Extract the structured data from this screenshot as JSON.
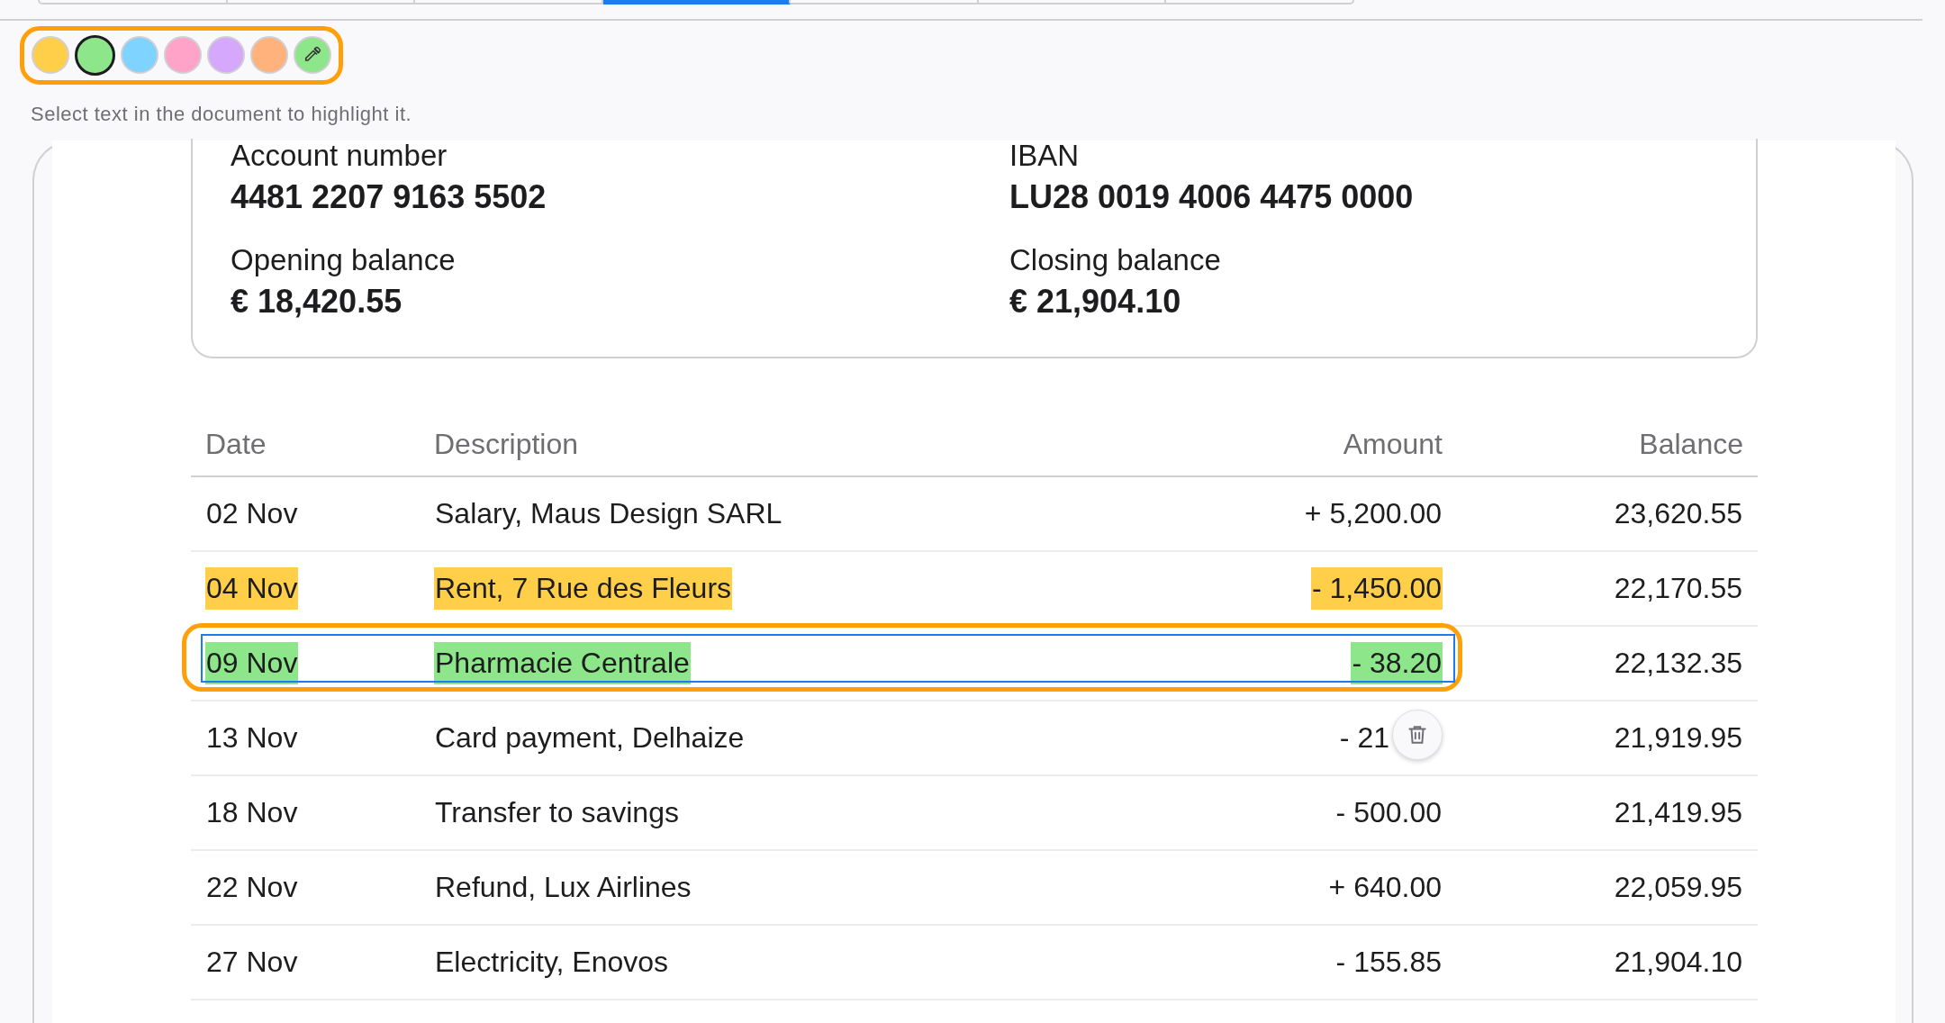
{
  "tabs": [
    {
      "selected": false
    },
    {
      "selected": false
    },
    {
      "selected": false
    },
    {
      "selected": true
    },
    {
      "selected": false
    },
    {
      "selected": false
    },
    {
      "selected": false
    }
  ],
  "highlighter": {
    "focused": true,
    "swatches": [
      {
        "kind": "color",
        "color": "#ffcf4a",
        "selected": false
      },
      {
        "kind": "color",
        "color": "#8de68a",
        "selected": true
      },
      {
        "kind": "color",
        "color": "#7fd3ff",
        "selected": false
      },
      {
        "kind": "color",
        "color": "#ffa3c9",
        "selected": false
      },
      {
        "kind": "color",
        "color": "#d5a8fb",
        "selected": false
      },
      {
        "kind": "color",
        "color": "#ffb27c",
        "selected": false
      },
      {
        "kind": "picker",
        "color": "#8de68a",
        "selected": false
      }
    ]
  },
  "hint": "Select text in the document to highlight it.",
  "account": [
    {
      "label": "Account number",
      "value": "4481 2207 9163 5502"
    },
    {
      "label": "IBAN",
      "value": "LU28 0019 4006 4475 0000"
    },
    {
      "label": "Opening balance",
      "value": "€ 18,420.55"
    },
    {
      "label": "Closing balance",
      "value": "€ 21,904.10"
    }
  ],
  "table": {
    "columns": [
      "Date",
      "Description",
      "Amount",
      "Balance"
    ],
    "rows": [
      {
        "date": "02 Nov",
        "description": "Salary, Maus Design SARL",
        "amount": "+ 5,200.00",
        "balance": "23,620.55",
        "selected": false,
        "delete_button": false
      },
      {
        "date": "04 Nov",
        "description": "Rent, 7 Rue des Fleurs",
        "amount": "- 1,450.00",
        "balance": "22,170.55",
        "color": "#ffcf4a",
        "selected": false,
        "delete_button": false
      },
      {
        "date": "09 Nov",
        "description": "Pharmacie Centrale",
        "amount": "- 38.20",
        "balance": "22,132.35",
        "color": "#8de68a",
        "selected": true,
        "delete_button": false
      },
      {
        "date": "13 Nov",
        "description": "Card payment, Delhaize",
        "amount": "- 21",
        "balance": "21,919.95",
        "selected": false,
        "delete_button": true
      },
      {
        "date": "18 Nov",
        "description": "Transfer to savings",
        "amount": "- 500.00",
        "balance": "21,419.95",
        "selected": false,
        "delete_button": false
      },
      {
        "date": "22 Nov",
        "description": "Refund, Lux Airlines",
        "amount": "+ 640.00",
        "balance": "22,059.95",
        "selected": false,
        "delete_button": false
      },
      {
        "date": "27 Nov",
        "description": "Electricity, Enovos",
        "amount": "- 155.85",
        "balance": "21,904.10",
        "selected": false,
        "delete_button": false
      }
    ]
  }
}
